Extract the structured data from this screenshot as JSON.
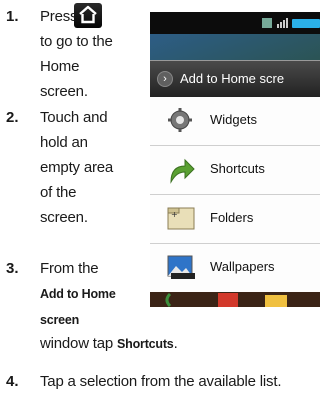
{
  "steps": [
    {
      "number": "1.",
      "lines": [
        "Press",
        "to go to the",
        "Home",
        "screen."
      ]
    },
    {
      "number": "2.",
      "lines": [
        "Touch and",
        "hold an",
        "empty area",
        "of the",
        "screen."
      ]
    },
    {
      "number": "3.",
      "lines": [
        "From the",
        "Add to Home",
        "screen",
        "window tap",
        "Shortcuts",
        "."
      ]
    },
    {
      "number": "4.",
      "lines": [
        "Tap a selection from the available list."
      ]
    }
  ],
  "phone": {
    "dialog_title": "Add to Home scre",
    "menu": [
      {
        "label": "Widgets",
        "icon": "gear-icon"
      },
      {
        "label": "Shortcuts",
        "icon": "green-arrow-icon"
      },
      {
        "label": "Folders",
        "icon": "folder-icon"
      },
      {
        "label": "Wallpapers",
        "icon": "wallpaper-icon"
      }
    ]
  },
  "colors": {
    "dialog_title_bg": "#2e2e2e",
    "arrow_green": "#5aa032"
  }
}
